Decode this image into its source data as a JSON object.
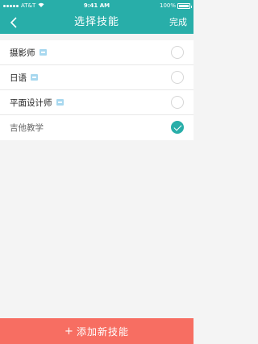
{
  "status_bar": {
    "carrier": "AT&T",
    "time": "9:41 AM",
    "battery": "100%"
  },
  "nav": {
    "title": "选择技能",
    "done_label": "完成"
  },
  "skills": [
    {
      "label": "摄影师",
      "has_tag": true,
      "checked": false
    },
    {
      "label": "日语",
      "has_tag": true,
      "checked": false
    },
    {
      "label": "平面设计师",
      "has_tag": true,
      "checked": false
    },
    {
      "label": "吉他教学",
      "has_tag": false,
      "checked": true
    }
  ],
  "footer": {
    "add_plus": "+",
    "add_label": "添加新技能"
  },
  "colors": {
    "primary": "#28aea9",
    "accent": "#f76e62",
    "tag": "#a8d8ef"
  }
}
